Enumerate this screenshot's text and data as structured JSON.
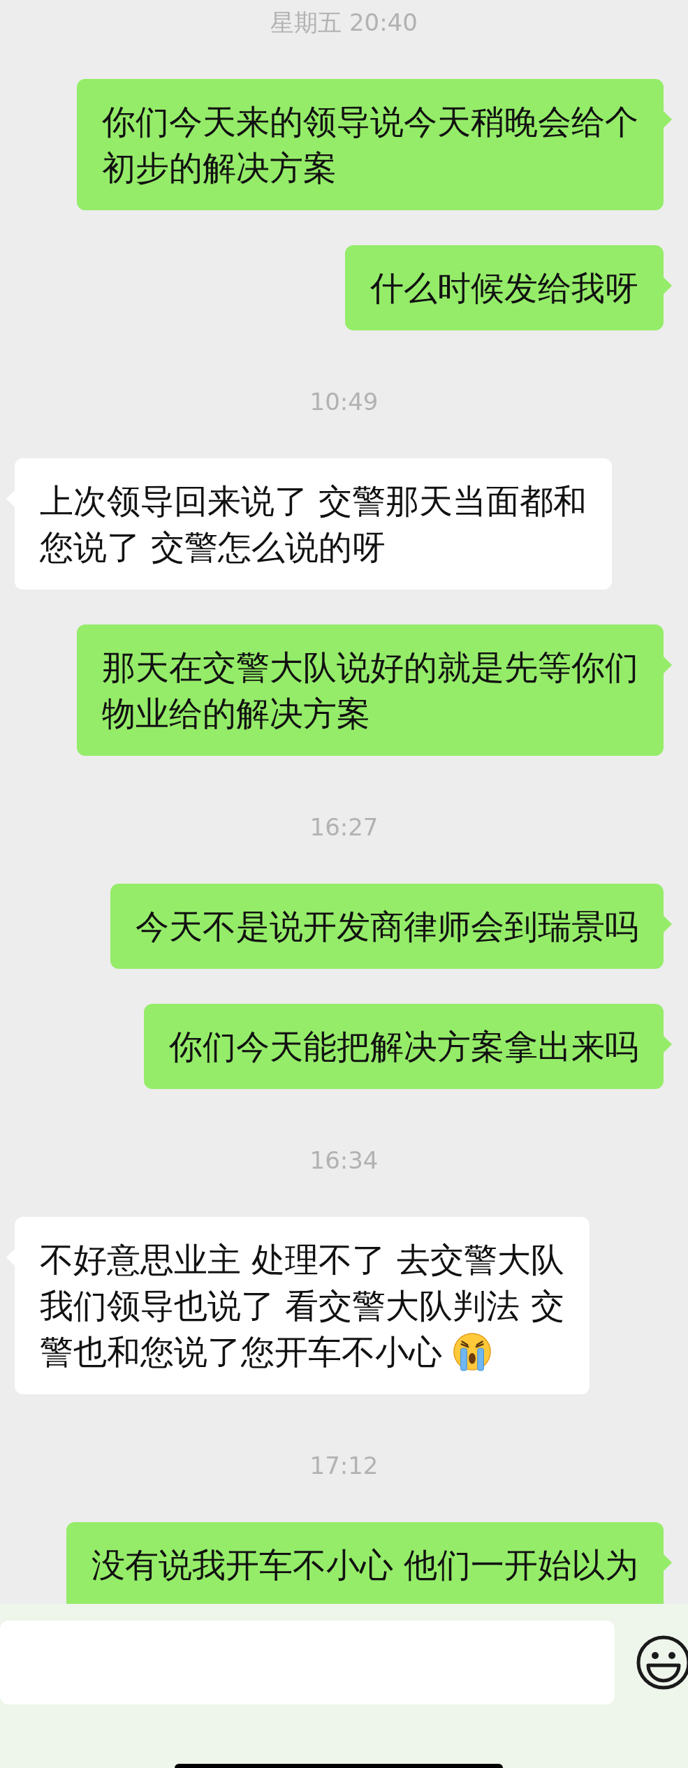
{
  "messages": [
    {
      "kind": "time",
      "text": "星期五 20:40"
    },
    {
      "kind": "message",
      "outgoing": true,
      "lines": [
        "你们今天来的领导说今天稍晚会给个",
        "初步的解决方案"
      ]
    },
    {
      "kind": "message",
      "outgoing": true,
      "lines": [
        "什么时候发给我呀"
      ]
    },
    {
      "kind": "time",
      "text": "10:49"
    },
    {
      "kind": "message",
      "outgoing": false,
      "lines": [
        "上次领导回来说了 交警那天当面都和",
        "您说了  交警怎么说的呀"
      ]
    },
    {
      "kind": "message",
      "outgoing": true,
      "lines": [
        "那天在交警大队说好的就是先等你们",
        "物业给的解决方案"
      ]
    },
    {
      "kind": "time",
      "text": "16:27"
    },
    {
      "kind": "message",
      "outgoing": true,
      "lines": [
        "今天不是说开发商律师会到瑞景吗"
      ]
    },
    {
      "kind": "message",
      "outgoing": true,
      "lines": [
        "你们今天能把解决方案拿出来吗"
      ]
    },
    {
      "kind": "time",
      "text": "16:34"
    },
    {
      "kind": "message",
      "outgoing": false,
      "lines": [
        "不好意思业主  处理不了 去交警大队",
        "我们领导也说了  看交警大队判法  交",
        "警也和您说了您开车不小心"
      ],
      "trailing_icon": true
    },
    {
      "kind": "time",
      "text": "17:12"
    },
    {
      "kind": "message",
      "outgoing": true,
      "lines": [
        "没有说我开车不小心 他们一开始以为"
      ]
    }
  ]
}
